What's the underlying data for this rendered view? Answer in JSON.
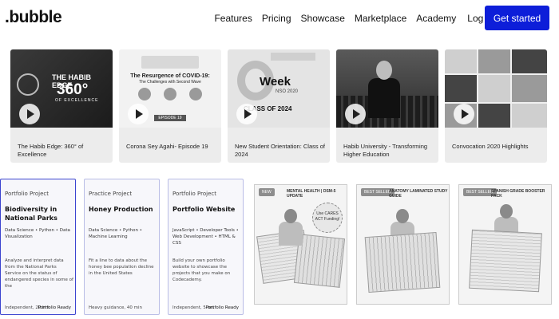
{
  "nav": {
    "logo": ".bubble",
    "links": [
      "Features",
      "Pricing",
      "Showcase",
      "Marketplace",
      "Academy"
    ],
    "login": "Log in",
    "cta": "Get started"
  },
  "videos": [
    {
      "title": "The Habib Edge: 360° of Excellence",
      "thumb_heading": "THE HABIB EDGE",
      "thumb_big": "360°",
      "thumb_sub": "OF EXCELLENCE"
    },
    {
      "title": "Corona Sey Agahi- Episode 19",
      "thumb_heading": "The Resurgence of COVID-19:",
      "thumb_sub": "The Challenges with Second Wave",
      "thumb_episode": "EPISODE 19"
    },
    {
      "title": "New Student Orientation: Class of 2024",
      "thumb_week": "Week",
      "thumb_nso": "NSO 2020",
      "thumb_class": "CLASS OF 2024"
    },
    {
      "title": "Habib University - Transforming Higher Education"
    },
    {
      "title": "Convocation 2020 Highlights"
    }
  ],
  "portfolio": [
    {
      "kind": "Portfolio Project",
      "title": "Biodiversity in National Parks",
      "tags": "Data Science • Python • Data Visualization",
      "desc": "Analyze and interpret data from the National Parks Service on the status of endangered species in some of the",
      "meta": "Independent, 20 hrs",
      "status": "Portfolio Ready"
    },
    {
      "kind": "Practice Project",
      "title": "Honey Production",
      "tags": "Data Science • Python • Machine Learning",
      "desc": "Fit a line to data about the honey bee population decline in the United States",
      "meta": "Heavy guidance, 40 min",
      "status": ""
    },
    {
      "kind": "Portfolio Project",
      "title": "Portfolio Website",
      "tags": "JavaScript • Developer Tools • Web Development • HTML & CSS",
      "desc": "Build your own portfolio website to showcase the projects that you make on Codecademy.",
      "meta": "Independent, 5 hrs",
      "status": "Portfolio Ready"
    }
  ],
  "products": [
    {
      "badge": "NEW",
      "label": "MENTAL HEALTH | DSM-5 UPDATE",
      "burst": "Use CARES ACT Funding!"
    },
    {
      "badge": "BEST SELLER",
      "label": "ANATOMY LAMINATED STUDY GUIDE"
    },
    {
      "badge": "BEST SELLER",
      "label": "SPANISH GRADE BOOSTER PACK"
    }
  ]
}
